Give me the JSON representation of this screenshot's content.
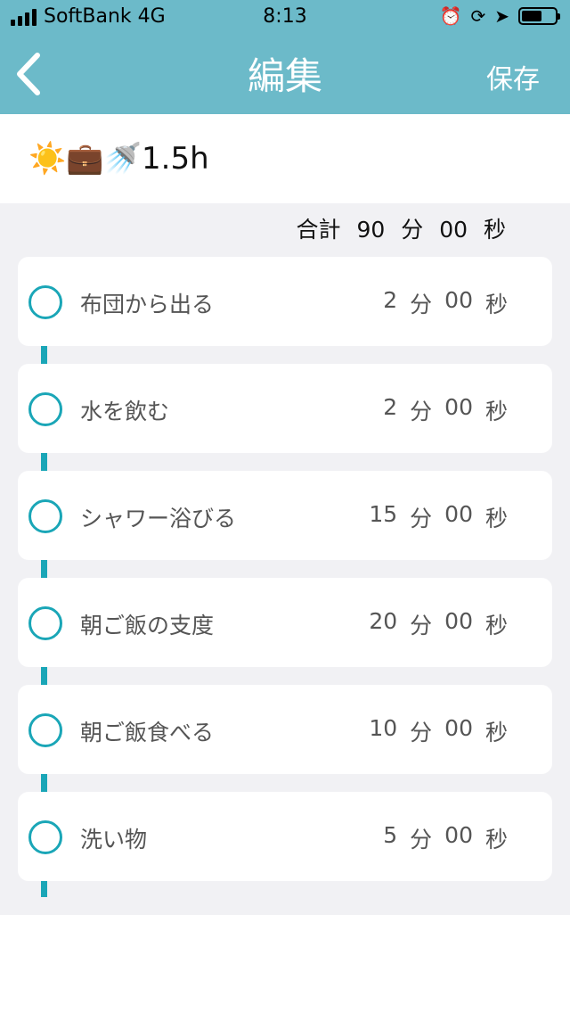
{
  "status_bar": {
    "carrier": "SoftBank 4G",
    "time": "8:13"
  },
  "nav": {
    "title": "編集",
    "save_label": "保存",
    "back_icon": "chevron-left-icon"
  },
  "routine": {
    "name": "☀️💼🚿1.5h"
  },
  "total": {
    "label": "合計",
    "minutes": "90",
    "min_unit": "分",
    "seconds": "00",
    "sec_unit": "秒"
  },
  "tasks": [
    {
      "label": "布団から出る",
      "minutes": "2",
      "min_unit": "分",
      "seconds": "00",
      "sec_unit": "秒"
    },
    {
      "label": "水を飲む",
      "minutes": "2",
      "min_unit": "分",
      "seconds": "00",
      "sec_unit": "秒"
    },
    {
      "label": "シャワー浴びる",
      "minutes": "15",
      "min_unit": "分",
      "seconds": "00",
      "sec_unit": "秒"
    },
    {
      "label": "朝ご飯の支度",
      "minutes": "20",
      "min_unit": "分",
      "seconds": "00",
      "sec_unit": "秒"
    },
    {
      "label": "朝ご飯食べる",
      "minutes": "10",
      "min_unit": "分",
      "seconds": "00",
      "sec_unit": "秒"
    },
    {
      "label": "洗い物",
      "minutes": "5",
      "min_unit": "分",
      "seconds": "00",
      "sec_unit": "秒"
    }
  ],
  "colors": {
    "header": "#6cbac9",
    "timeline": "#1aa6b7",
    "background": "#f1f1f4"
  }
}
